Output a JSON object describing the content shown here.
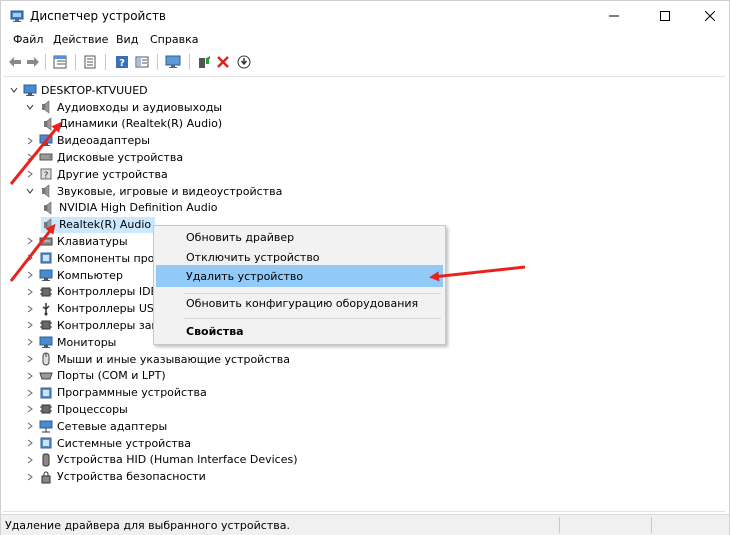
{
  "window": {
    "title": "Диспетчер устройств"
  },
  "menu": [
    "Файл",
    "Действие",
    "Вид",
    "Справка"
  ],
  "toolbar_icons": [
    "back-icon",
    "forward-icon",
    "view-list-icon",
    "properties-icon",
    "help-icon",
    "view-details-icon",
    "monitor-icon",
    "add-driver-icon",
    "remove-icon",
    "update-icon"
  ],
  "tree": {
    "root": "DESKTOP-KTVUUED",
    "items": [
      {
        "label": "Аудиовходы и аудиовыходы",
        "expanded": true
      },
      {
        "label": "Динамики (Realtek(R) Audio)"
      },
      {
        "label": "Видеоадаптеры"
      },
      {
        "label": "Дисковые устройства"
      },
      {
        "label": "Другие устройства"
      },
      {
        "label": "Звуковые, игровые и видеоустройства",
        "expanded": true
      },
      {
        "label": "NVIDIA High Definition Audio"
      },
      {
        "label": "Realtek(R) Audio"
      },
      {
        "label": "Клавиатуры"
      },
      {
        "label": "Компоненты прог"
      },
      {
        "label": "Компьютер"
      },
      {
        "label": "Контроллеры IDE"
      },
      {
        "label": "Контроллеры USE"
      },
      {
        "label": "Контроллеры зап"
      },
      {
        "label": "Мониторы"
      },
      {
        "label": "Мыши и иные указывающие устройства"
      },
      {
        "label": "Порты (COM и LPT)"
      },
      {
        "label": "Программные устройства"
      },
      {
        "label": "Процессоры"
      },
      {
        "label": "Сетевые адаптеры"
      },
      {
        "label": "Системные устройства"
      },
      {
        "label": "Устройства HID (Human Interface Devices)"
      },
      {
        "label": "Устройства безопасности"
      }
    ]
  },
  "context_menu": {
    "items": [
      "Обновить драйвер",
      "Отключить устройство",
      "Удалить устройство",
      "Обновить конфигурацию оборудования",
      "Свойства"
    ],
    "highlighted": "Удалить устройство"
  },
  "status": {
    "text": "Удаление драйвера для выбранного устройства."
  },
  "colors": {
    "selection": "#cce8ff",
    "menu_highlight": "#91c9f7",
    "annotation_arrow": "#e8231e"
  }
}
